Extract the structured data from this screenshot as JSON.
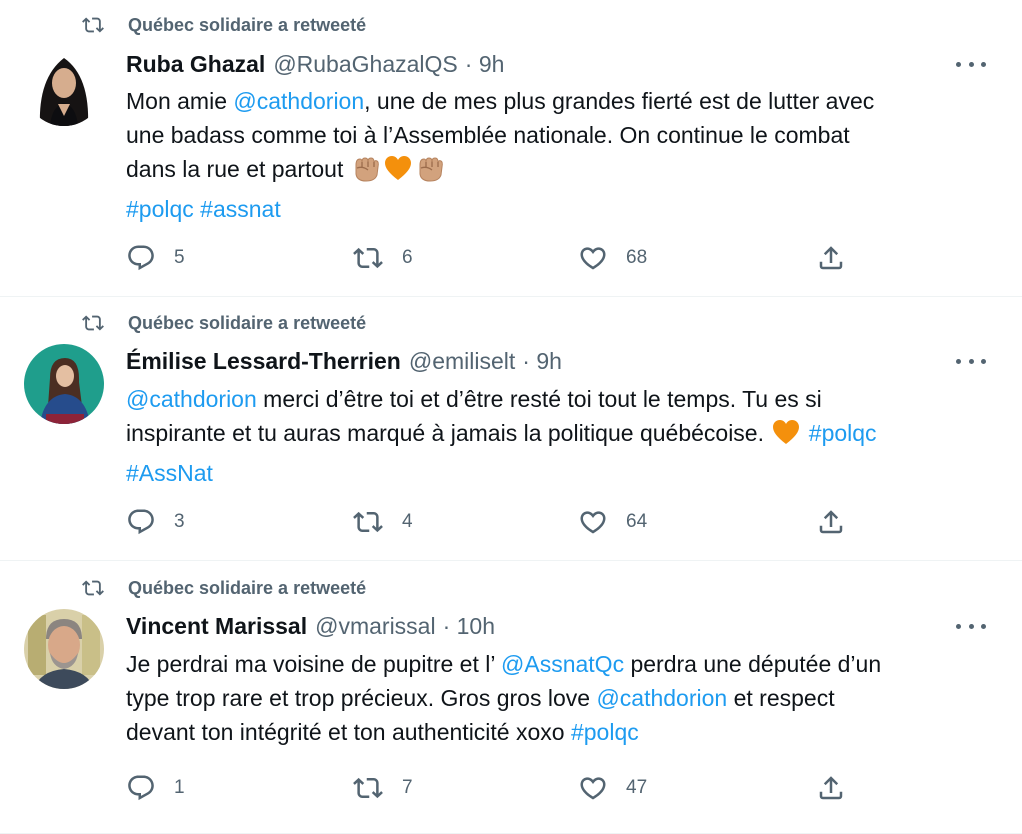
{
  "colors": {
    "accent": "#1d9bf0",
    "secondary_text": "#536471",
    "primary_text": "#0f1419",
    "divider": "#eff3f4"
  },
  "tweets": [
    {
      "retweeted_by": "Québec solidaire a retweeté",
      "name": "Ruba Ghazal",
      "handle": "@RubaGhazalQS",
      "time": "· 9h",
      "lines": [
        {
          "pre": "Mon amie ",
          "link": "@cathdorion",
          "post": ", une de mes plus grandes fierté est de lutter avec"
        },
        {
          "text": "une badass comme toi à l’Assemblée nationale. On continue le combat"
        },
        {
          "text": "dans la rue et partout",
          "emojis": [
            "raised-fist-emoji",
            "orange-heart-emoji",
            "raised-fist-emoji"
          ]
        },
        {
          "tags": [
            "#polqc",
            "#assnat"
          ]
        }
      ],
      "replies": "5",
      "retweets": "6",
      "likes": "68"
    },
    {
      "retweeted_by": "Québec solidaire a retweeté",
      "name": "Émilise Lessard-Therrien",
      "handle": "@emiliselt",
      "time": "· 9h",
      "lines": [
        {
          "link": "@cathdorion",
          "post": " merci d’être toi et d’être resté toi tout le temps. Tu es si"
        },
        {
          "text": "inspirante et tu auras marqué à jamais la politique québécoise.",
          "tag": "#polqc"
        },
        {
          "tag": "#AssNat"
        }
      ],
      "replies": "3",
      "retweets": "4",
      "likes": "64"
    },
    {
      "retweeted_by": "Québec solidaire a retweeté",
      "name": "Vincent Marissal",
      "handle": "@vmarissal",
      "time": "· 10h",
      "lines": [
        {
          "pre": "Je perdrai ma voisine de pupitre et l’ ",
          "link": "@AssnatQc",
          "post": " perdra une députée d’un"
        },
        {
          "pre": "type trop rare et trop précieux. Gros gros love ",
          "link": "@cathdorion",
          "post": " et respect"
        },
        {
          "pre": "devant ton intégrité et ton authenticité xoxo ",
          "tag": "#polqc"
        }
      ],
      "replies": "1",
      "retweets": "7",
      "likes": "47"
    }
  ]
}
